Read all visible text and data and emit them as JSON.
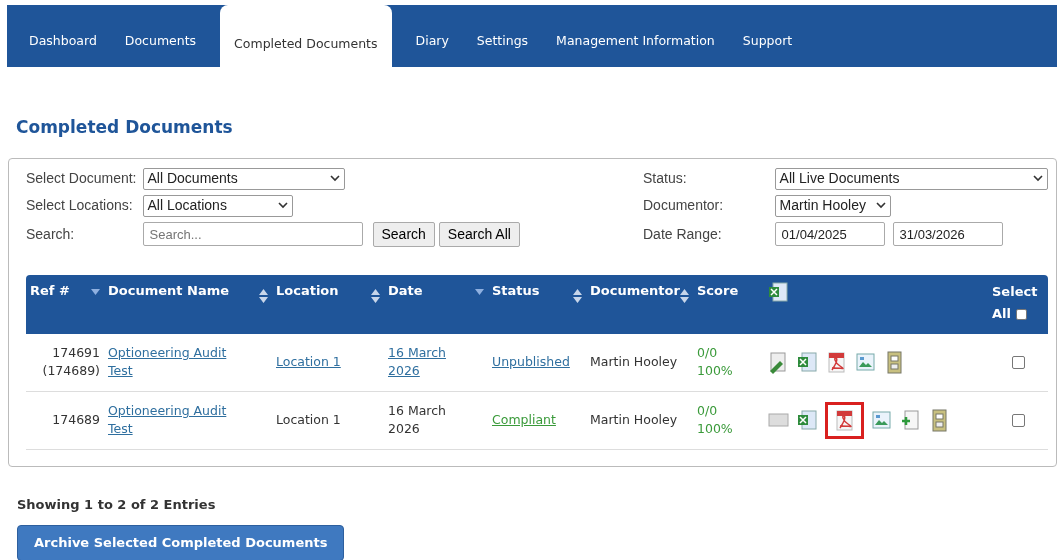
{
  "nav": {
    "tabs": [
      {
        "label": "Dashboard",
        "selected": false
      },
      {
        "label": "Documents",
        "selected": false
      },
      {
        "label": "Completed Documents",
        "selected": true
      },
      {
        "label": "Diary",
        "selected": false
      },
      {
        "label": "Settings",
        "selected": false
      },
      {
        "label": "Management Information",
        "selected": false
      },
      {
        "label": "Support",
        "selected": false
      }
    ]
  },
  "heading": "Completed Documents",
  "filters": {
    "left": [
      {
        "label": "Select Document:",
        "kind": "select",
        "value": "All Documents"
      },
      {
        "label": "Select Locations:",
        "kind": "select",
        "value": "All Locations"
      },
      {
        "label": "Search:",
        "kind": "search",
        "placeholder": "Search...",
        "buttons": [
          "Search",
          "Search All"
        ]
      }
    ],
    "right": [
      {
        "label": "Status:",
        "kind": "select",
        "value": "All Live Documents"
      },
      {
        "label": "Documentor:",
        "kind": "select",
        "value": "Martin Hooley"
      },
      {
        "label": "Date Range:",
        "kind": "dates",
        "values": [
          "01/04/2025",
          "31/03/2026"
        ]
      }
    ]
  },
  "table": {
    "columns": [
      {
        "label": "Ref #",
        "kind": "sorted"
      },
      {
        "label": "Document Name",
        "kind": "sortable"
      },
      {
        "label": "Location",
        "kind": "sortable"
      },
      {
        "label": "Date",
        "kind": "sorted"
      },
      {
        "label": "Status",
        "kind": "sortable"
      },
      {
        "label": "Documentor",
        "kind": "sortable"
      },
      {
        "label": "Score",
        "kind": "plain"
      },
      {
        "kind": "export"
      },
      {
        "label": "Select All",
        "kind": "select-all",
        "checked": false
      }
    ],
    "rows": [
      {
        "ref": "174691",
        "ref_parent": "(174689)",
        "name": "Optioneering Audit Test",
        "location": "Location 1",
        "location_linked": true,
        "date": "16 March 2026",
        "date_linked": true,
        "status": {
          "text": "Unpublished",
          "color": "#2f6f9f"
        },
        "documentor": "Martin Hooley",
        "score": "0/0",
        "percent": "100%",
        "icons": [
          {
            "kind": "edit",
            "highlighted": false
          },
          {
            "kind": "excel",
            "highlighted": false
          },
          {
            "kind": "pdf",
            "highlighted": false
          },
          {
            "kind": "image",
            "highlighted": false
          },
          {
            "kind": "archive",
            "highlighted": false
          }
        ],
        "checked": false
      },
      {
        "ref": "174689",
        "name": "Optioneering Audit Test",
        "location": "Location 1",
        "location_linked": false,
        "date": "16 March 2026",
        "date_linked": false,
        "status": {
          "text": "Compliant",
          "color": "#3a9a3a"
        },
        "documentor": "Martin Hooley",
        "score": "0/0",
        "percent": "100%",
        "icons": [
          {
            "kind": "blank",
            "highlighted": false
          },
          {
            "kind": "excel",
            "highlighted": false
          },
          {
            "kind": "pdf",
            "highlighted": true
          },
          {
            "kind": "image",
            "highlighted": false
          },
          {
            "kind": "add",
            "highlighted": false
          },
          {
            "kind": "archive",
            "highlighted": false
          }
        ],
        "checked": false
      }
    ]
  },
  "summary": "Showing 1 to 2 of 2 Entries",
  "archive_button": "Archive Selected Completed Documents"
}
